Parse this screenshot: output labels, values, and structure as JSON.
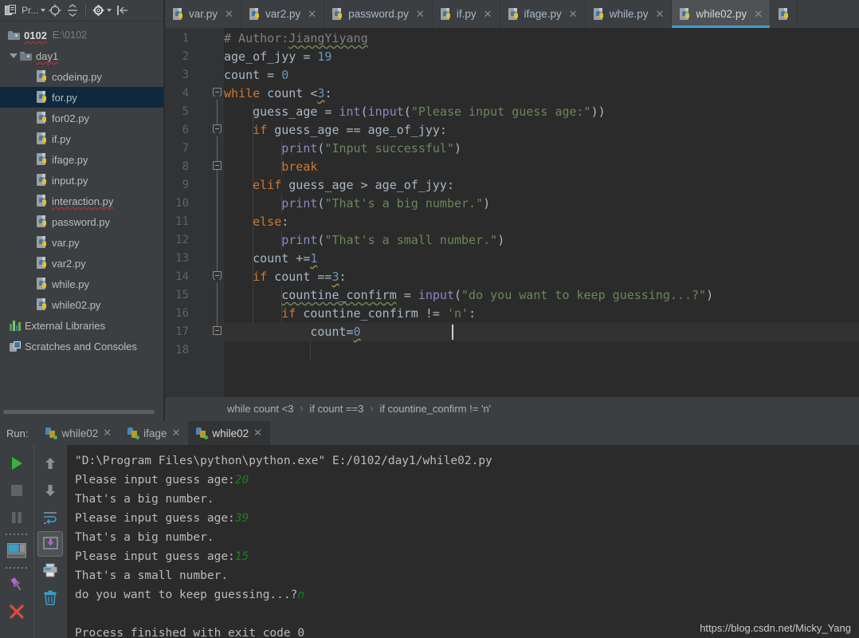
{
  "sidebar": {
    "toolbar": {
      "project_label": "Pr...",
      "project_icon": "project-view-icon",
      "locate_icon": "locate-target-icon",
      "collapse_icon": "collapse-all-icon",
      "settings_icon": "gear-icon",
      "hide_icon": "hide-panel-icon"
    },
    "root": {
      "name": "0102",
      "path": "E:\\0102",
      "icon": "folder-icon"
    },
    "items": [
      {
        "label": "day1",
        "icon": "folder-icon",
        "depth": 1,
        "expanded": true,
        "selected": false,
        "kind": "folder"
      },
      {
        "label": "codeing.py",
        "icon": "python-file-icon",
        "depth": 2,
        "selected": false,
        "kind": "file"
      },
      {
        "label": "for.py",
        "icon": "python-file-icon",
        "depth": 2,
        "selected": true,
        "kind": "file"
      },
      {
        "label": "for02.py",
        "icon": "python-file-icon",
        "depth": 2,
        "selected": false,
        "kind": "file"
      },
      {
        "label": "if.py",
        "icon": "python-file-icon",
        "depth": 2,
        "selected": false,
        "kind": "file"
      },
      {
        "label": "ifage.py",
        "icon": "python-file-icon",
        "depth": 2,
        "selected": false,
        "kind": "file"
      },
      {
        "label": "input.py",
        "icon": "python-file-icon",
        "depth": 2,
        "selected": false,
        "kind": "file"
      },
      {
        "label": "interaction.py",
        "icon": "python-file-icon",
        "depth": 2,
        "selected": false,
        "kind": "file",
        "misspelled": true
      },
      {
        "label": "password.py",
        "icon": "python-file-icon",
        "depth": 2,
        "selected": false,
        "kind": "file"
      },
      {
        "label": "var.py",
        "icon": "python-file-icon",
        "depth": 2,
        "selected": false,
        "kind": "file"
      },
      {
        "label": "var2.py",
        "icon": "python-file-icon",
        "depth": 2,
        "selected": false,
        "kind": "file"
      },
      {
        "label": "while.py",
        "icon": "python-file-icon",
        "depth": 2,
        "selected": false,
        "kind": "file"
      },
      {
        "label": "while02.py",
        "icon": "python-file-icon",
        "depth": 2,
        "selected": false,
        "kind": "file"
      },
      {
        "label": "External Libraries",
        "icon": "external-libraries-icon",
        "depth": 0,
        "selected": false,
        "kind": "libs"
      },
      {
        "label": "Scratches and Consoles",
        "icon": "scratches-icon",
        "depth": 0,
        "selected": false,
        "kind": "scratch"
      }
    ]
  },
  "editor_tabs": [
    {
      "label": "var.py",
      "active": false,
      "icon": "python-file-icon"
    },
    {
      "label": "var2.py",
      "active": false,
      "icon": "python-file-icon"
    },
    {
      "label": "password.py",
      "active": false,
      "icon": "python-file-icon"
    },
    {
      "label": "if.py",
      "active": false,
      "icon": "python-file-icon"
    },
    {
      "label": "ifage.py",
      "active": false,
      "icon": "python-file-icon"
    },
    {
      "label": "while.py",
      "active": false,
      "icon": "python-file-icon"
    },
    {
      "label": "while02.py",
      "active": true,
      "icon": "python-file-icon"
    }
  ],
  "editor": {
    "line_numbers": [
      1,
      2,
      3,
      4,
      5,
      6,
      7,
      8,
      9,
      10,
      11,
      12,
      13,
      14,
      15,
      16,
      17,
      18
    ],
    "current_line": 17,
    "caret_line": 17,
    "lines": [
      {
        "n": 1,
        "text": "# Author:JiangYiyang"
      },
      {
        "n": 2,
        "text": "age_of_jyy = 19"
      },
      {
        "n": 3,
        "text": "count = 0"
      },
      {
        "n": 4,
        "text": "while count <3:"
      },
      {
        "n": 5,
        "text": "    guess_age = int(input(\"Please input guess age:\"))"
      },
      {
        "n": 6,
        "text": "    if guess_age == age_of_jyy:"
      },
      {
        "n": 7,
        "text": "        print(\"Input successful\")"
      },
      {
        "n": 8,
        "text": "        break"
      },
      {
        "n": 9,
        "text": "    elif guess_age > age_of_jyy:"
      },
      {
        "n": 10,
        "text": "        print(\"That's a big number.\")"
      },
      {
        "n": 11,
        "text": "    else:"
      },
      {
        "n": 12,
        "text": "        print(\"That's a small number.\")"
      },
      {
        "n": 13,
        "text": "    count +=1"
      },
      {
        "n": 14,
        "text": "    if count ==3:"
      },
      {
        "n": 15,
        "text": "        countine_confirm = input(\"do you want to keep guessing...?\")"
      },
      {
        "n": 16,
        "text": "        if countine_confirm != 'n':"
      },
      {
        "n": 17,
        "text": "            count=0"
      },
      {
        "n": 18,
        "text": ""
      }
    ],
    "fold_markers": [
      {
        "line": 4,
        "type": "start"
      },
      {
        "line": 6,
        "type": "start"
      },
      {
        "line": 8,
        "type": "end"
      },
      {
        "line": 14,
        "type": "start"
      },
      {
        "line": 17,
        "type": "end"
      }
    ]
  },
  "breadcrumb": {
    "items": [
      "while count <3",
      "if count ==3",
      "if countine_confirm != 'n'"
    ],
    "separator": "›"
  },
  "run_panel": {
    "title": "Run:",
    "tabs": [
      {
        "label": "while02",
        "active": false,
        "icon": "python-run-icon"
      },
      {
        "label": "ifage",
        "active": false,
        "icon": "python-run-icon"
      },
      {
        "label": "while02",
        "active": true,
        "icon": "python-run-icon"
      }
    ],
    "left_buttons": [
      {
        "name": "rerun-button",
        "icon": "play-icon"
      },
      {
        "name": "stop-button",
        "icon": "stop-icon"
      },
      {
        "name": "pause-button",
        "icon": "pause-icon"
      },
      {
        "name": "restore-layout-button",
        "icon": "restore-layout-icon"
      },
      {
        "name": "pin-tab-button",
        "icon": "pin-icon"
      },
      {
        "name": "close-button",
        "icon": "close-x-icon"
      }
    ],
    "right_buttons": [
      {
        "name": "up-button",
        "icon": "arrow-up-icon"
      },
      {
        "name": "down-button",
        "icon": "arrow-down-icon"
      },
      {
        "name": "soft-wrap-button",
        "icon": "soft-wrap-icon"
      },
      {
        "name": "scroll-to-end-button",
        "icon": "scroll-to-end-icon",
        "selected": true
      },
      {
        "name": "print-button",
        "icon": "printer-icon"
      },
      {
        "name": "clear-all-button",
        "icon": "trash-icon"
      }
    ],
    "console": [
      {
        "text": "\"D:\\Program Files\\python\\python.exe\" E:/0102/day1/while02.py",
        "input": ""
      },
      {
        "text": "Please input guess age:",
        "input": "20"
      },
      {
        "text": "That's a big number.",
        "input": ""
      },
      {
        "text": "Please input guess age:",
        "input": "39"
      },
      {
        "text": "That's a big number.",
        "input": ""
      },
      {
        "text": "Please input guess age:",
        "input": "15"
      },
      {
        "text": "That's a small number.",
        "input": ""
      },
      {
        "text": "do you want to keep guessing...?",
        "input": "n"
      },
      {
        "text": "",
        "input": ""
      },
      {
        "text": "Process finished with exit code 0",
        "input": ""
      }
    ]
  },
  "watermark": "https://blog.csdn.net/Micky_Yang",
  "colors": {
    "editor_bg": "#2b2b2b",
    "panel_bg": "#3c3f41",
    "gutter_bg": "#313335",
    "selection_blue": "#0d293e",
    "accent_underline": "#3b9ccc",
    "keyword": "#cc7832",
    "string": "#6a8759",
    "number": "#6897bb",
    "function": "#8888c6",
    "comment": "#808080",
    "identifier": "#a9b7c6",
    "console_input": "#1a7f1a"
  }
}
